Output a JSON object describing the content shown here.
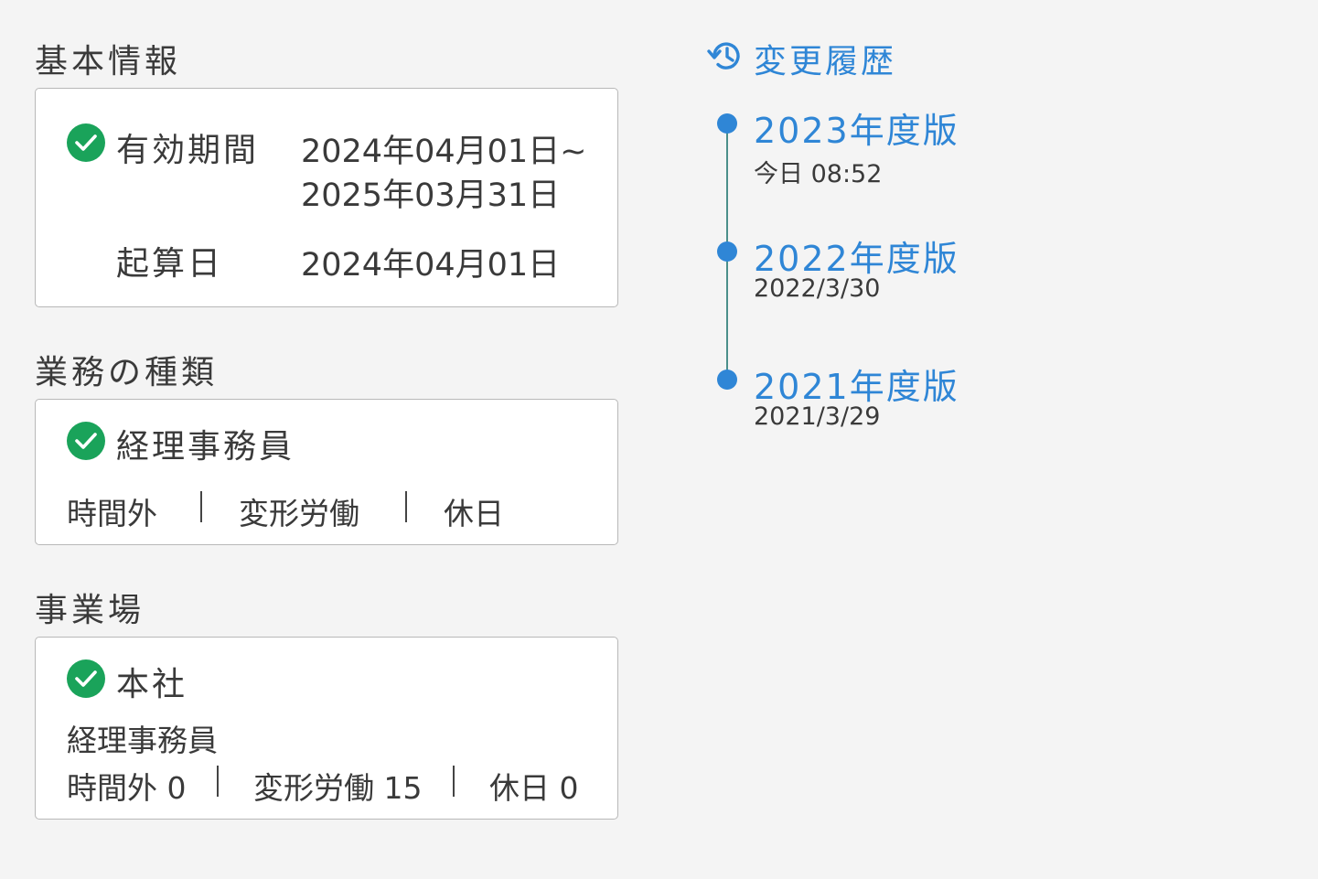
{
  "basic_info": {
    "title": "基本情報",
    "validity_label": "有効期間",
    "validity_line1": "2024年04月01日~",
    "validity_line2": "2025年03月31日",
    "start_label": "起算日",
    "start_value": "2024年04月01日"
  },
  "work_type": {
    "title": "業務の種類",
    "name": "経理事務員",
    "tags": [
      "時間外",
      "変形労働",
      "休日"
    ]
  },
  "workplace": {
    "title": "事業場",
    "name": "本社",
    "job": "経理事務員",
    "stats": [
      "時間外 0",
      "変形労働 15",
      "休日 0"
    ]
  },
  "history": {
    "title": "変更履歴",
    "icon": "history-icon",
    "items": [
      {
        "version": "2023年度版",
        "date": "今日 08:52"
      },
      {
        "version": "2022年度版",
        "date": "2022/3/30"
      },
      {
        "version": "2021年度版",
        "date": "2021/3/29"
      }
    ]
  },
  "colors": {
    "accent": "#2f86d6",
    "check": "#1aa35a",
    "muted": "#b3b3b3",
    "text": "#3a3a3a",
    "background": "#f4f4f4"
  }
}
